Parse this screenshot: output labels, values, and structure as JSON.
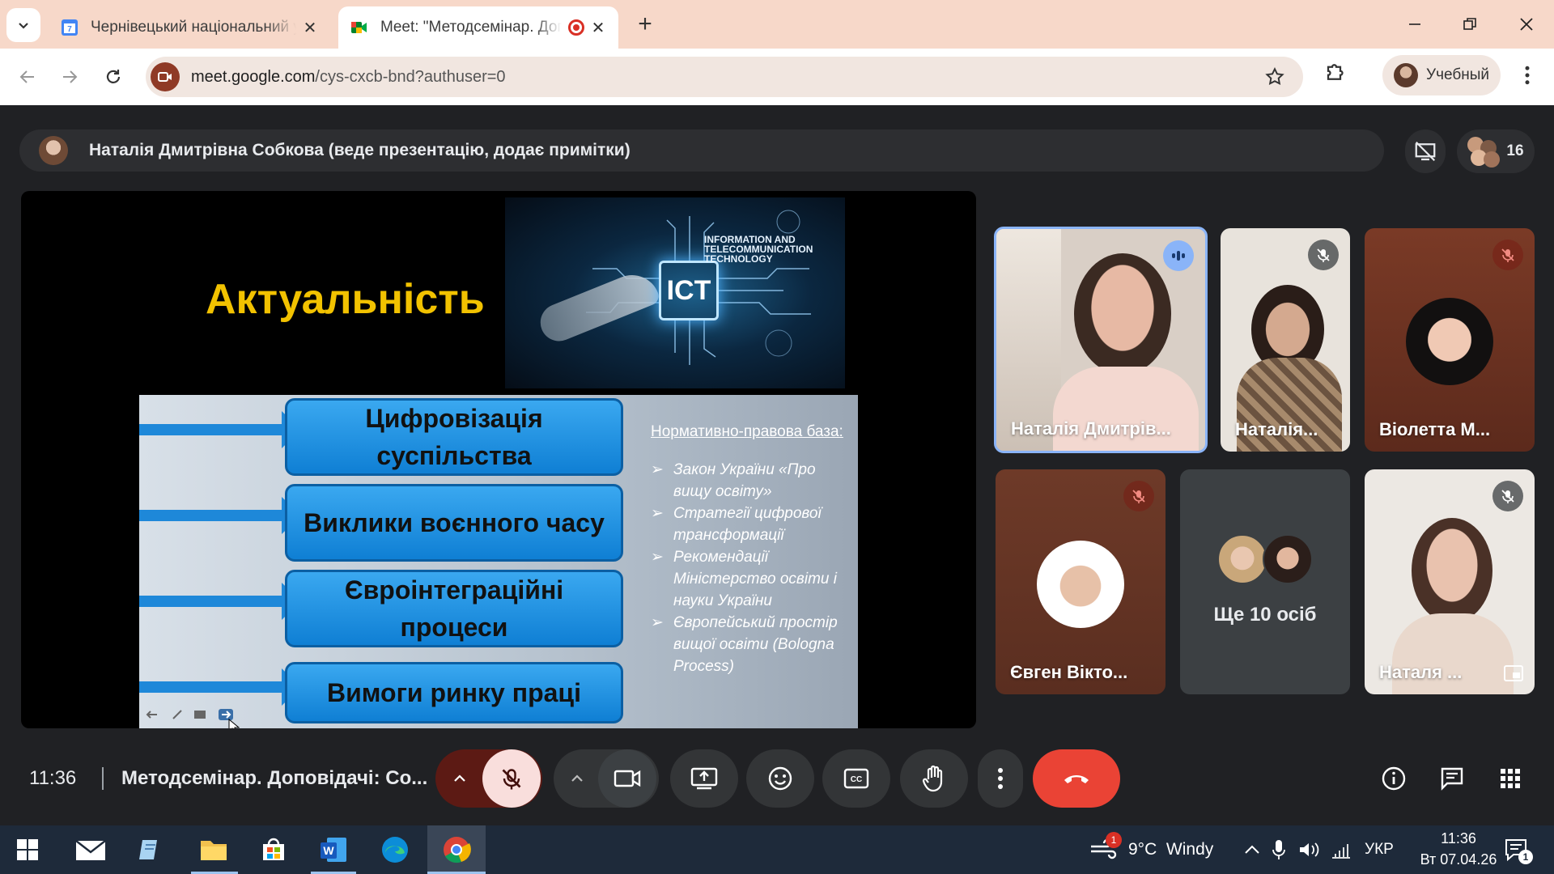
{
  "browser": {
    "tabs": [
      {
        "title": "Чернівецький національний у",
        "active": false
      },
      {
        "title": "Meet: \"Методсемінар. Доп",
        "active": true,
        "recording": true
      }
    ],
    "url_host": "meet.google.com",
    "url_path": "/cys-cxcb-bnd?authuser=0",
    "profile_name": "Учебный"
  },
  "meet": {
    "presenter_banner": "Наталія Дмитрівна Собкова (веде презентацію, додає примітки)",
    "participant_count": "16",
    "slide": {
      "title": "Актуальність",
      "ict_label": "INFORMATION AND TELECOMMUNICATION TECHNOLOGY",
      "ict_chip": "ICT",
      "boxes": [
        "Цифровізація суспільства",
        "Виклики воєнного часу",
        "Євроінтеграційні процеси",
        "Вимоги ринку праці"
      ],
      "norm_heading": "Нормативно-правова база:",
      "norm_items": [
        "Закон України «Про вищу освіту»",
        "Стратегії цифрової трансформації",
        "Рекомендації Міністерство освіти і науки України",
        "Європейський простір вищої освіти (Bologna Process)"
      ]
    },
    "tiles": [
      {
        "name": "Наталія Дмитрів...",
        "mic": "speaking"
      },
      {
        "name": "Наталія...",
        "mic": "muted"
      },
      {
        "name": "Віолетта М...",
        "mic": "muted"
      },
      {
        "name": "Євген Вікто...",
        "mic": "muted"
      },
      {
        "name": "Ще 10 осіб",
        "mic": "none"
      },
      {
        "name": "Наталя ...",
        "mic": "muted"
      }
    ],
    "time": "11:36",
    "meeting_title": "Методсемінар. Доповідачі: Со..."
  },
  "taskbar": {
    "weather": "9°C  Windy",
    "weather_badge": "1",
    "language": "УКР",
    "clock_time": "11:36",
    "clock_date": "Вт 07.04.26",
    "notif_count": "1"
  },
  "colors": {
    "meet_bg": "#202124",
    "end_call": "#ea4335",
    "tab_strip": "#f7d8c9",
    "slide_title": "#f2c200"
  }
}
